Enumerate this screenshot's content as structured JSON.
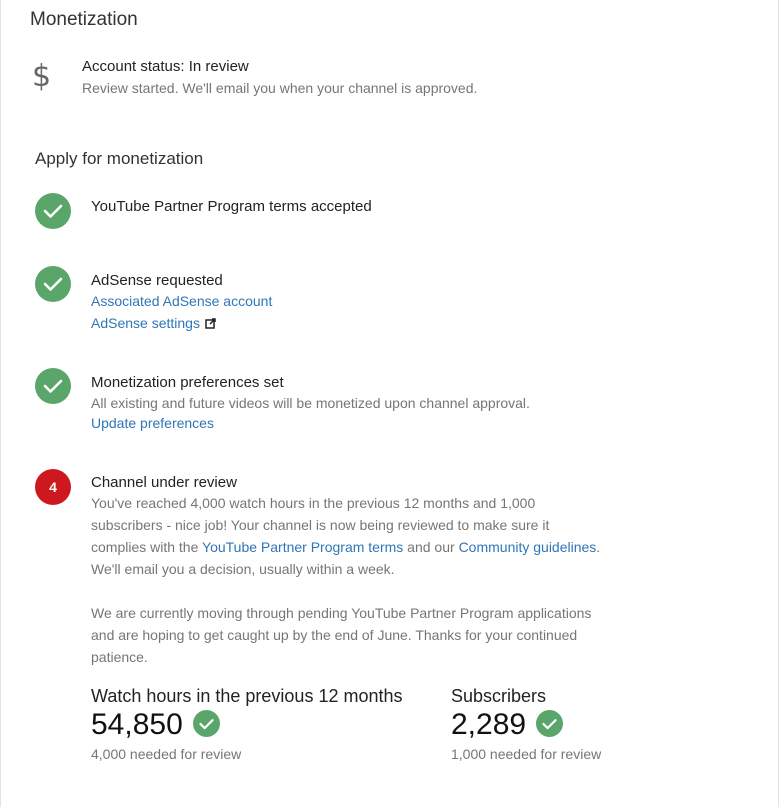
{
  "page": {
    "title": "Monetization"
  },
  "account_status": {
    "icon": "dollar-icon",
    "title": "Account status: In review",
    "subtitle": "Review started. We'll email you when your channel is approved."
  },
  "apply": {
    "title": "Apply for monetization",
    "steps": [
      {
        "state": "done",
        "title": "YouTube Partner Program terms accepted"
      },
      {
        "state": "done",
        "title": "AdSense requested",
        "links": [
          "Associated AdSense account",
          "AdSense settings"
        ]
      },
      {
        "state": "done",
        "title": "Monetization preferences set",
        "text": "All existing and future videos will be monetized upon channel approval.",
        "link": "Update preferences"
      },
      {
        "state": "current",
        "number": "4",
        "title": "Channel under review",
        "p1_line1": "You've reached 4,000 watch hours in the previous 12 months and 1,000",
        "p1_line2": "subscribers - nice job! Your channel is now being reviewed to make sure it",
        "p1_line3_pre": "complies with the ",
        "p1_link1": "YouTube Partner Program terms",
        "p1_line3_mid": " and our ",
        "p1_link2": "Community guidelines",
        "p1_line3_post": ".",
        "p1_line4": "We'll email you a decision, usually within a week.",
        "p2_line1": "We are currently moving through pending YouTube Partner Program applications",
        "p2_line2": "and are hoping to get caught up by the end of June. Thanks for your continued",
        "p2_line3": "patience."
      }
    ]
  },
  "stats": {
    "watch_hours": {
      "label": "Watch hours in the previous 12 months",
      "value": "54,850",
      "requirement": "4,000 needed for review"
    },
    "subscribers": {
      "label": "Subscribers",
      "value": "2,289",
      "requirement": "1,000 needed for review"
    }
  },
  "colors": {
    "success": "#5aa56a",
    "alert": "#cc181e",
    "link": "#2f76b7"
  }
}
